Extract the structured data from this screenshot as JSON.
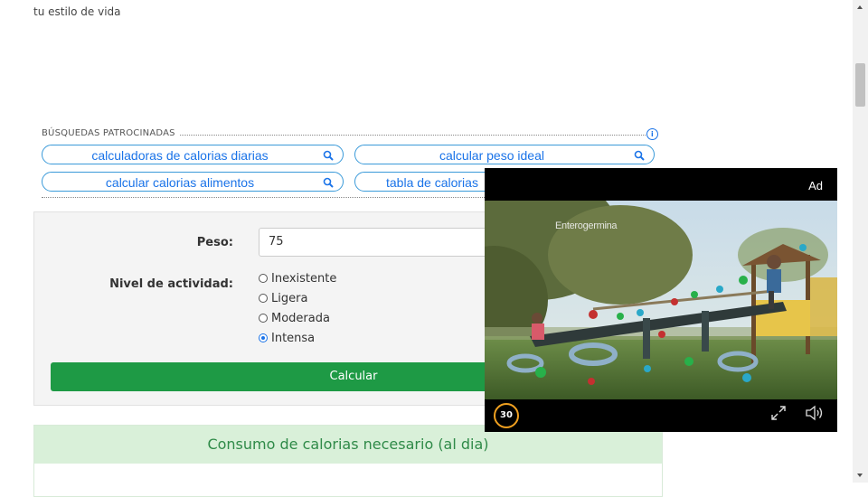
{
  "intro_text": "tu estilo de vida",
  "sponsored": {
    "heading": "BÚSQUEDAS PATROCINADAS",
    "info_glyph": "i",
    "pills": [
      {
        "label": "calculadoras de calorias diarias"
      },
      {
        "label": "calcular peso ideal"
      },
      {
        "label": "calcular calorias alimentos"
      },
      {
        "label": "tabla de calorias"
      }
    ]
  },
  "form": {
    "weight_label": "Peso:",
    "weight_value": "75",
    "activity_label": "Nivel de actividad:",
    "activity_options": [
      {
        "label": "Inexistente",
        "selected": false
      },
      {
        "label": "Ligera",
        "selected": false
      },
      {
        "label": "Moderada",
        "selected": false
      },
      {
        "label": "Intensa",
        "selected": true
      }
    ],
    "submit_label": "Calcular"
  },
  "result": {
    "heading": "Consumo de calorias necesario (al dia)"
  },
  "video_ad": {
    "ad_label": "Ad",
    "brand_text": "Enterogermina",
    "countdown": "30"
  },
  "colors": {
    "pill_text": "#1a73e8",
    "button_bg": "#1e9a45",
    "result_header_bg": "#d9f0d9",
    "result_header_text": "#2f8a48",
    "countdown_ring": "#f0a020"
  }
}
